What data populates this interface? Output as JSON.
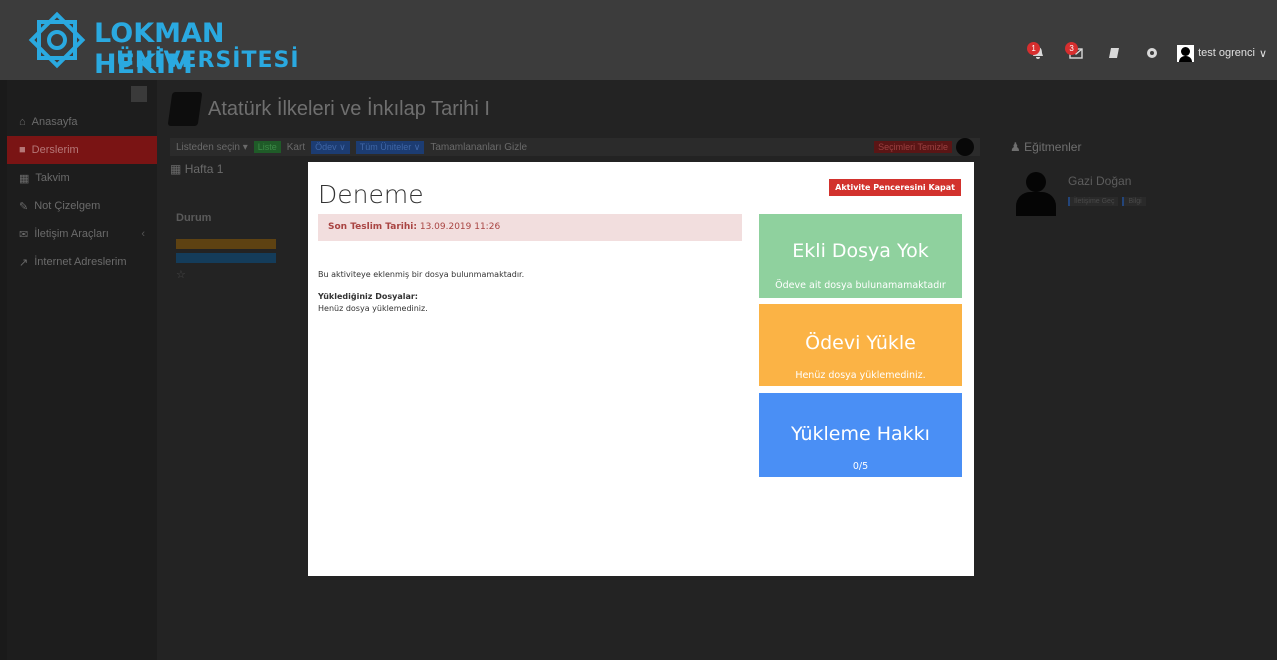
{
  "header": {
    "logo_line1": "LOKMAN HEKİM",
    "logo_line2": "ÜNİVERSİTESİ",
    "notifications_count": "1",
    "messages_count": "3",
    "user_name": "test ogrenci"
  },
  "sidebar": {
    "items": [
      {
        "label": "Anasayfa"
      },
      {
        "label": "Derslerim"
      },
      {
        "label": "Takvim"
      },
      {
        "label": "Not Çizelgem"
      },
      {
        "label": "İletişim Araçları"
      },
      {
        "label": "İnternet Adreslerim"
      }
    ]
  },
  "course": {
    "title": "Atatürk İlkeleri ve İnkılap Tarihi I",
    "toolbar": {
      "select_label": "Listeden seçin",
      "liste": "Liste",
      "kart": "Kart",
      "odev": "Ödev",
      "units": "Tüm Üniteler",
      "hide_completed": "Tamamlananları Gizle",
      "clear_selection": "Seçimleri Temizle"
    },
    "week": "Hafta 1",
    "status_header": "Durum",
    "instructors_title": "Eğitmenler",
    "instructor_name": "Gazi Doğan",
    "instructor_contact": "İletişime Geç",
    "instructor_info": "Bilgi"
  },
  "modal": {
    "title": "Deneme",
    "close_button": "Aktivite Penceresini Kapat",
    "due_label": "Son Teslim Tarihi:",
    "due_value": "13.09.2019 11:26",
    "no_file_text": "Bu aktiviteye eklenmiş bir dosya bulunmamaktadır.",
    "uploaded_label": "Yüklediğiniz Dosyalar:",
    "uploaded_value": "Henüz dosya yüklemediniz.",
    "tiles": [
      {
        "title": "Ekli Dosya Yok",
        "subtitle": "Ödeve ait dosya bulunamamaktadır",
        "color": "#8fd19e"
      },
      {
        "title": "Ödevi Yükle",
        "subtitle": "Henüz dosya yüklemediniz.",
        "color": "#fbb345"
      },
      {
        "title": "Yükleme Hakkı",
        "subtitle": "0/5",
        "color": "#4a8ff5"
      }
    ]
  }
}
